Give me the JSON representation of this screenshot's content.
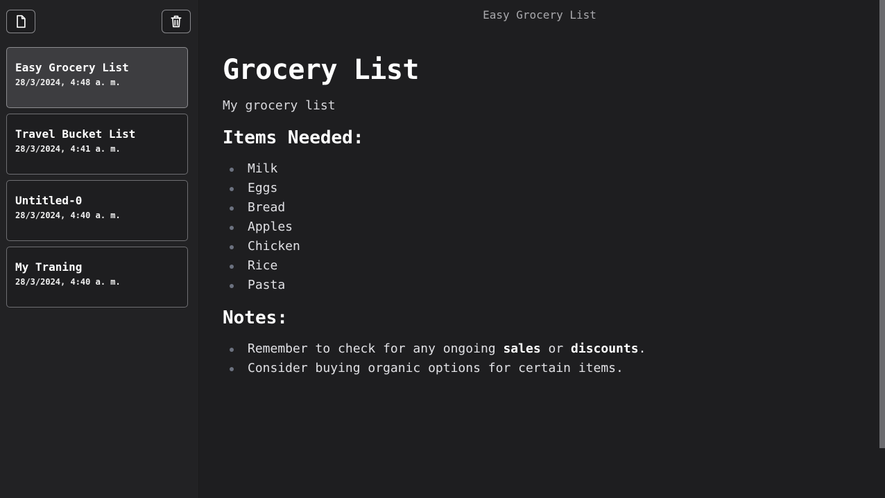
{
  "sidebar": {
    "new_note_icon": "new-document-icon",
    "delete_icon": "trash-icon",
    "notes": [
      {
        "title": "Easy Grocery List",
        "date": "28/3/2024, 4:48 a. m."
      },
      {
        "title": "Travel Bucket List",
        "date": "28/3/2024, 4:41 a. m."
      },
      {
        "title": "Untitled-0",
        "date": "28/3/2024, 4:40 a. m."
      },
      {
        "title": "My Traning",
        "date": "28/3/2024, 4:40 a. m."
      }
    ]
  },
  "main": {
    "header_title": "Easy Grocery List",
    "heading": "Grocery List",
    "description": "My grocery list",
    "items_heading": "Items Needed:",
    "items": [
      "Milk",
      "Eggs",
      "Bread",
      "Apples",
      "Chicken",
      "Rice",
      "Pasta"
    ],
    "notes_heading": "Notes:",
    "notes": {
      "line1_prefix": "Remember to check for any ongoing ",
      "line1_bold1": "sales",
      "line1_mid": " or ",
      "line1_bold2": "discounts",
      "line1_suffix": ".",
      "line2": "Consider buying organic options for certain items."
    }
  },
  "colors": {
    "background": "#1e1e20",
    "sidebar": "#222224",
    "active_card": "#3d3d40",
    "bullet": "#6c7280"
  }
}
